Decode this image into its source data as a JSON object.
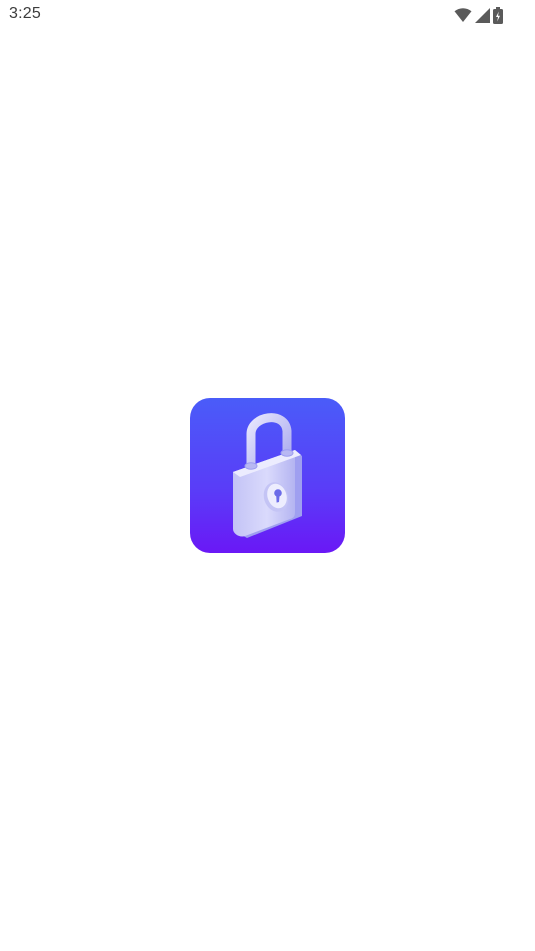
{
  "status_bar": {
    "time": "3:25",
    "icons": [
      "wifi-icon",
      "cellular-signal-icon",
      "battery-icon"
    ]
  },
  "splash": {
    "logo_icon": "padlock-icon",
    "logo_colors": {
      "gradient_top": "#4a5cf9",
      "gradient_bottom": "#6a18f6",
      "lock_body": "#d4d4fb"
    }
  }
}
